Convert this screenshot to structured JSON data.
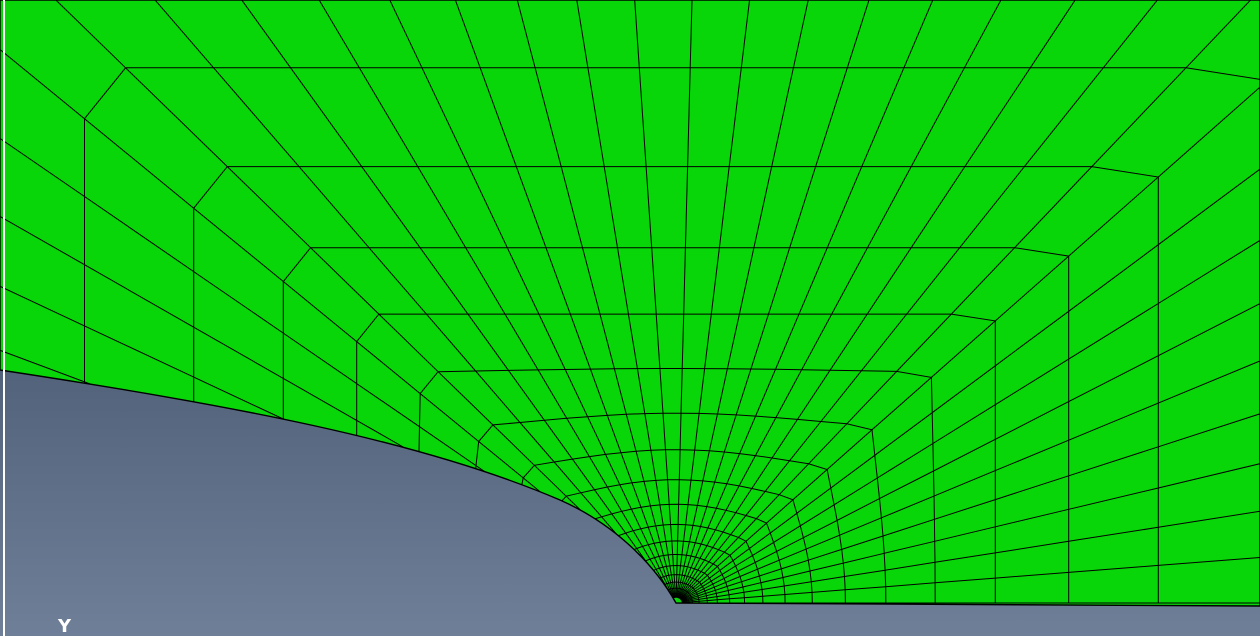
{
  "viewport": {
    "background_top": "#2b3a52",
    "background_bottom": "#6f7f98",
    "mesh_fill": "#08d608",
    "mesh_line": "#000000"
  },
  "triad": {
    "axis_label": "Y"
  }
}
